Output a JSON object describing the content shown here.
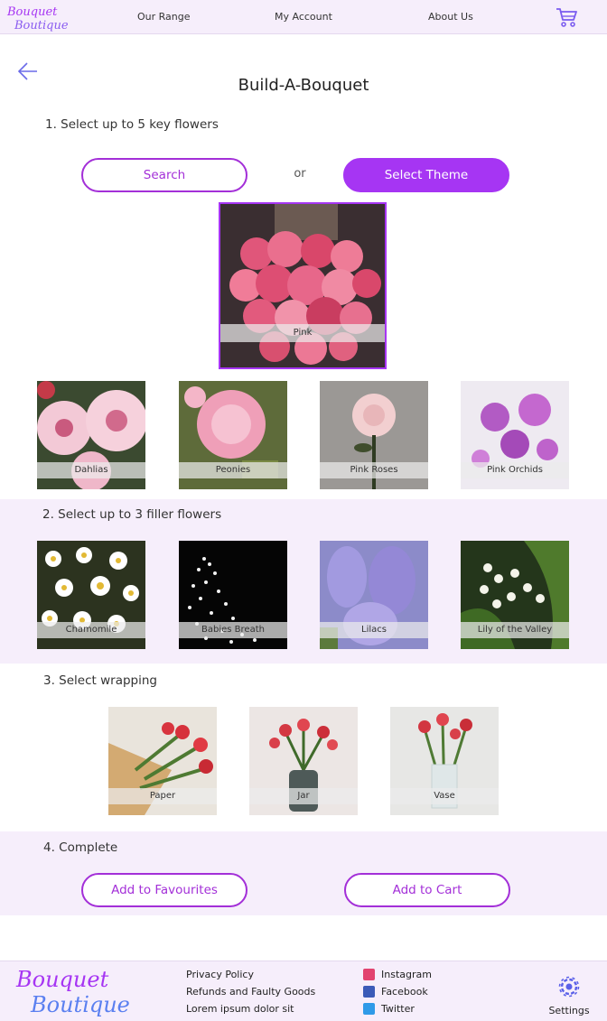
{
  "brand": {
    "line1": "Bouquet",
    "line2": "Boutique",
    "accent": "#a635f3"
  },
  "nav": {
    "items": [
      "Our Range",
      "My Account",
      "About Us"
    ],
    "cart_icon": "cart-icon"
  },
  "page": {
    "title": "Build-A-Bouquet",
    "back_icon": "arrow-left-icon"
  },
  "step1": {
    "label": "1.  Select up to 5 key flowers",
    "search_label": "Search",
    "or_text": "or",
    "theme_label": "Select Theme",
    "selected_theme": "Pink",
    "flowers": [
      "Dahlias",
      "Peonies",
      "Pink Roses",
      "Pink Orchids"
    ]
  },
  "step2": {
    "label": "2. Select up to 3 filler flowers",
    "flowers": [
      "Chamomile",
      "Babies Breath",
      "Lilacs",
      "Lily of the Valley"
    ]
  },
  "step3": {
    "label": "3. Select wrapping",
    "options": [
      "Paper",
      "Jar",
      "Vase"
    ]
  },
  "step4": {
    "label": "4. Complete",
    "favourites_label": "Add to Favourites",
    "cart_label": "Add to Cart"
  },
  "footer": {
    "links": [
      "Privacy Policy",
      "Refunds and Faulty Goods",
      "Lorem ipsum dolor sit"
    ],
    "social": [
      {
        "label": "Instagram",
        "icon": "instagram-icon"
      },
      {
        "label": "Facebook",
        "icon": "facebook-icon"
      },
      {
        "label": "Twitter",
        "icon": "twitter-icon"
      }
    ],
    "settings_label": "Settings",
    "settings_icon": "gear-icon"
  }
}
